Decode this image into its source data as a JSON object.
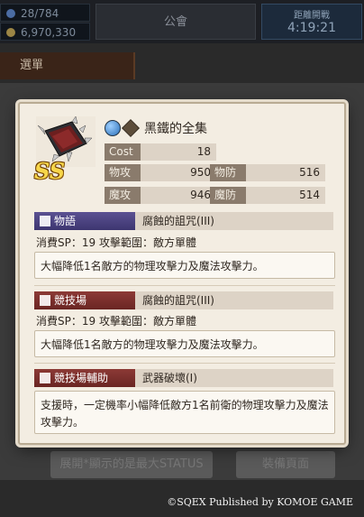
{
  "background": {
    "resource_gem": "28/784",
    "resource_coin": "6,970,330",
    "notice_label": "公會",
    "timer_label": "距離開戰",
    "timer_value": "4:19:21",
    "tab_label": "選單",
    "bottom_left_label": "展開*顯示的是最大STATUS",
    "bottom_right_label": "裝備頁面"
  },
  "equipment": {
    "name": "黑鐵的全集",
    "rank": "SS",
    "element_icon": "water-orb-icon",
    "type_icon": "weapon-type-icon",
    "stats": {
      "cost_label": "Cost",
      "cost_value": "18",
      "atk_label": "物攻",
      "atk_value": "950",
      "def_label": "物防",
      "def_value": "516",
      "matk_label": "魔攻",
      "matk_value": "946",
      "mdef_label": "魔防",
      "mdef_value": "514"
    }
  },
  "sections": {
    "story": {
      "label": "物語",
      "icon": "book-icon",
      "skill_name": "腐蝕的詛咒(III)",
      "meta": "消費SP：19 攻擊範圍：敵方單體",
      "description": "大幅降低1名敵方的物理攻擊力及魔法攻擊力。"
    },
    "arena": {
      "label": "競技場",
      "icon": "crossed-swords-icon",
      "skill_name": "腐蝕的詛咒(III)",
      "meta": "消費SP：19 攻擊範圍：敵方單體",
      "description": "大幅降低1名敵方的物理攻擊力及魔法攻擊力。"
    },
    "arena_support": {
      "label": "競技場輔助",
      "icon": "crossed-swords-icon",
      "skill_name": "武器破壞(I)",
      "description": "支援時，一定機率小幅降低敵方1名前衛的物理攻擊力及魔法攻擊力。"
    }
  },
  "copyright": "©SQEX Published by KOMOE GAME"
}
